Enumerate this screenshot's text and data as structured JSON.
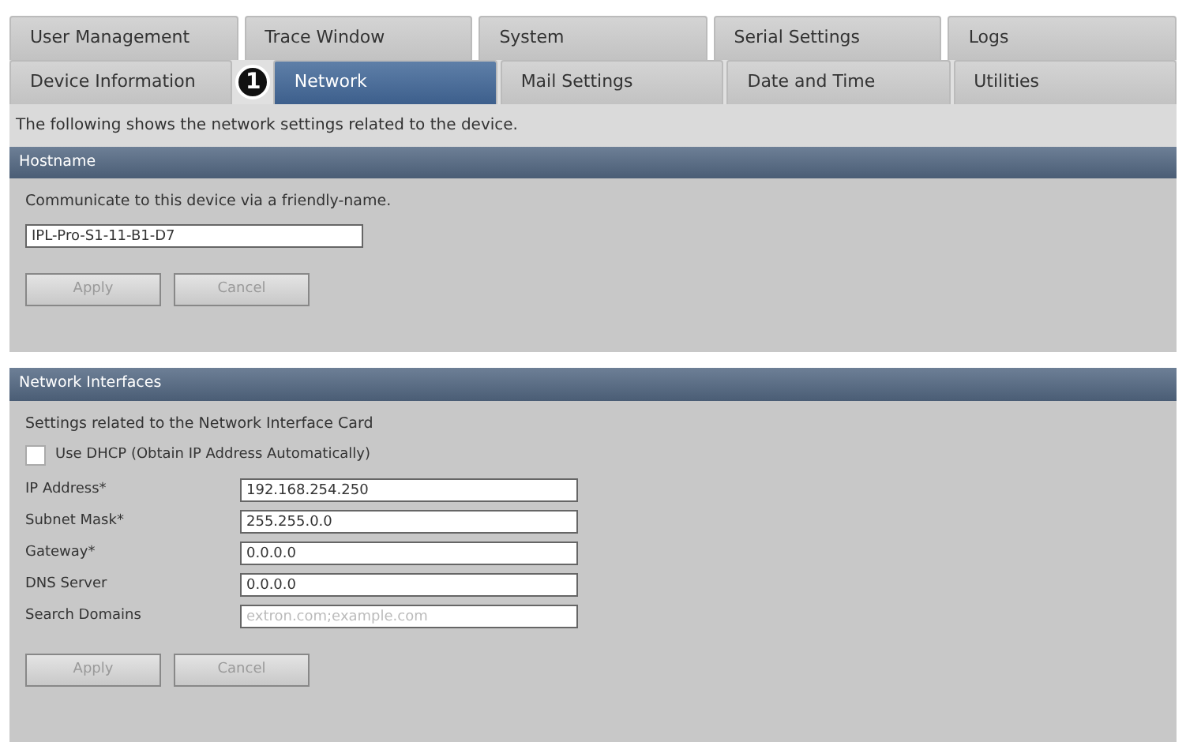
{
  "tab_rows": [
    [
      {
        "label": "User Management",
        "selected": false
      },
      {
        "label": "Trace Window",
        "selected": false
      },
      {
        "label": "System",
        "selected": false
      },
      {
        "label": "Serial Settings",
        "selected": false
      },
      {
        "label": "Logs",
        "selected": false
      }
    ],
    [
      {
        "label": "Device Information",
        "selected": false
      },
      {
        "label": "Network",
        "selected": true
      },
      {
        "label": "Mail Settings",
        "selected": false
      },
      {
        "label": "Date and Time",
        "selected": false
      },
      {
        "label": "Utilities",
        "selected": false
      }
    ]
  ],
  "callout": "1",
  "description": "The following shows the network settings related to the device.",
  "hostname": {
    "title": "Hostname",
    "hint": "Communicate to this device via a friendly-name.",
    "value": "IPL-Pro-S1-11-B1-D7",
    "buttons": [
      "Apply",
      "Cancel"
    ]
  },
  "network_interfaces": {
    "title": "Network Interfaces",
    "hint": "Settings related to the Network Interface Card",
    "dhcp": {
      "label": "Use DHCP (Obtain IP Address Automatically)",
      "checked": false
    },
    "fields": [
      {
        "label": "IP Address*",
        "value": "192.168.254.250"
      },
      {
        "label": "Subnet Mask*",
        "value": "255.255.0.0"
      },
      {
        "label": "Gateway*",
        "value": "0.0.0.0"
      },
      {
        "label": "DNS Server",
        "value": "0.0.0.0"
      },
      {
        "label": "Search Domains",
        "placeholder": "extron.com;example.com"
      }
    ],
    "buttons": [
      "Apply",
      "Cancel"
    ]
  }
}
